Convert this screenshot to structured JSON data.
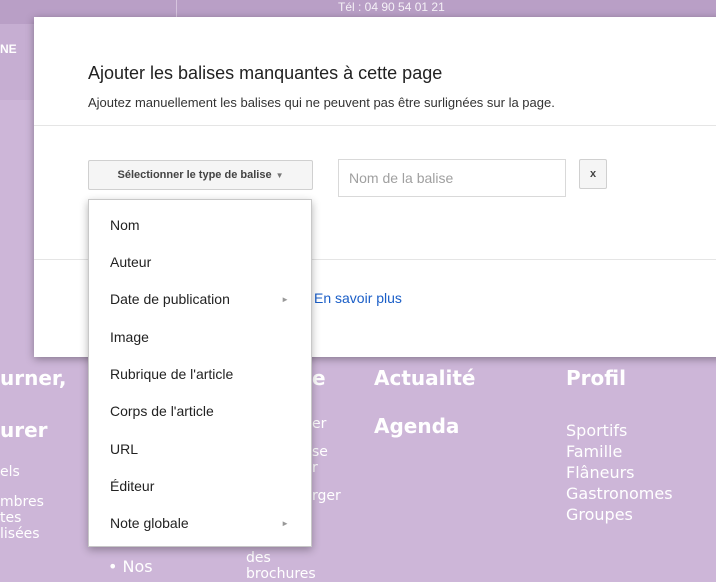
{
  "background": {
    "phone": "Tél : 04 90 54 01 21",
    "nav_fragment": "NE",
    "columns": [
      {
        "lines": [
          "urner,",
          "",
          "urer",
          "els",
          "mbres",
          "tes",
          "lisées"
        ]
      },
      {
        "lines": [
          "e",
          "er",
          "se",
          "r",
          "rger",
          "des",
          "brochures",
          "• Nos"
        ]
      },
      {
        "heading": "Actualité",
        "sub": "Agenda"
      },
      {
        "heading": "Profil",
        "items": [
          "Sportifs",
          "Famille",
          "Flâneurs",
          "Gastronomes",
          "Groupes"
        ]
      }
    ]
  },
  "dialog": {
    "title": "Ajouter les balises manquantes à cette page",
    "subtitle": "Ajoutez manuellement les balises qui ne peuvent pas être surlignées sur la page.",
    "type_button_label": "Sélectionner le type de balise",
    "name_placeholder": "Nom de la balise",
    "remove_label": "x",
    "learn_more": "En savoir plus"
  },
  "menu": {
    "items": [
      {
        "label": "Nom"
      },
      {
        "label": "Auteur"
      },
      {
        "label": "Date de publication",
        "submenu": true
      },
      {
        "label": "Image"
      },
      {
        "label": "Rubrique de l'article"
      },
      {
        "label": "Corps de l'article"
      },
      {
        "label": "URL"
      },
      {
        "label": "Éditeur"
      },
      {
        "label": "Note globale",
        "submenu": true
      }
    ]
  },
  "colors": {
    "page_background": "#cdb6d8",
    "link": "#1a5ec7"
  }
}
